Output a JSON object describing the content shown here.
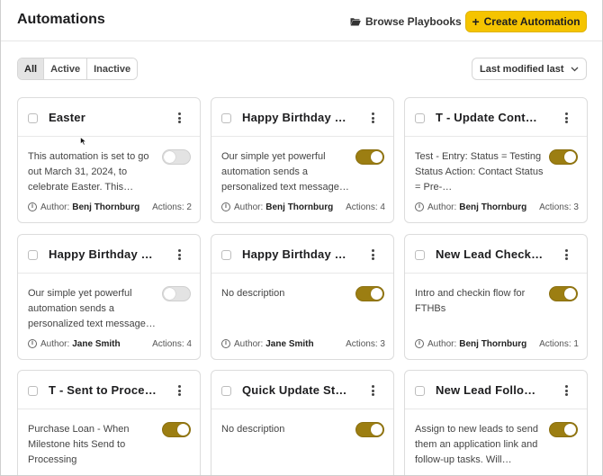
{
  "header": {
    "title": "Automations",
    "browse_label": "Browse Playbooks",
    "create_label": "Create Automation",
    "create_icon": "plus-icon",
    "browse_icon": "folder-open-icon"
  },
  "filters": {
    "items": [
      {
        "label": "All",
        "active": true
      },
      {
        "label": "Active",
        "active": false
      },
      {
        "label": "Inactive",
        "active": false
      }
    ]
  },
  "sort": {
    "selected": "Last modified last"
  },
  "colors": {
    "accent": "#f5c400",
    "toggle_on": "#9c7e12"
  },
  "cards": [
    {
      "title": "Easter",
      "description": "This automation is set to go out March 31, 2024, to celebrate Easter. This…",
      "enabled": false,
      "author_label": "Author:",
      "author": "Benj Thornburg",
      "actions": "Actions: 2"
    },
    {
      "title": "Happy Birthday …",
      "description": "Our simple yet powerful automation sends a personalized text message…",
      "enabled": true,
      "author_label": "Author:",
      "author": "Benj Thornburg",
      "actions": "Actions: 4"
    },
    {
      "title": "T - Update Cont…",
      "description": "Test - Entry: Status = Testing Status Action: Contact Status = Pre-…",
      "enabled": true,
      "author_label": "Author:",
      "author": "Benj Thornburg",
      "actions": "Actions: 3"
    },
    {
      "title": "Happy Birthday …",
      "description": "Our simple yet powerful automation sends a personalized text message…",
      "enabled": false,
      "author_label": "Author:",
      "author": "Jane Smith",
      "actions": "Actions: 4"
    },
    {
      "title": "Happy Birthday …",
      "description": "No description",
      "enabled": true,
      "author_label": "Author:",
      "author": "Jane Smith",
      "actions": "Actions: 3"
    },
    {
      "title": "New Lead Check…",
      "description": "Intro and checkin flow for FTHBs",
      "enabled": true,
      "author_label": "Author:",
      "author": "Benj Thornburg",
      "actions": "Actions: 1"
    },
    {
      "title": "T - Sent to Proce…",
      "description": "Purchase Loan - When Milestone hits Send to Processing",
      "enabled": true,
      "author_label": "",
      "author": "",
      "actions": ""
    },
    {
      "title": "Quick Update St…",
      "description": "No description",
      "enabled": true,
      "author_label": "",
      "author": "",
      "actions": ""
    },
    {
      "title": "New Lead Follo…",
      "description": "Assign to new leads to send them an application link and follow-up tasks. Will…",
      "enabled": true,
      "author_label": "",
      "author": "",
      "actions": ""
    }
  ]
}
